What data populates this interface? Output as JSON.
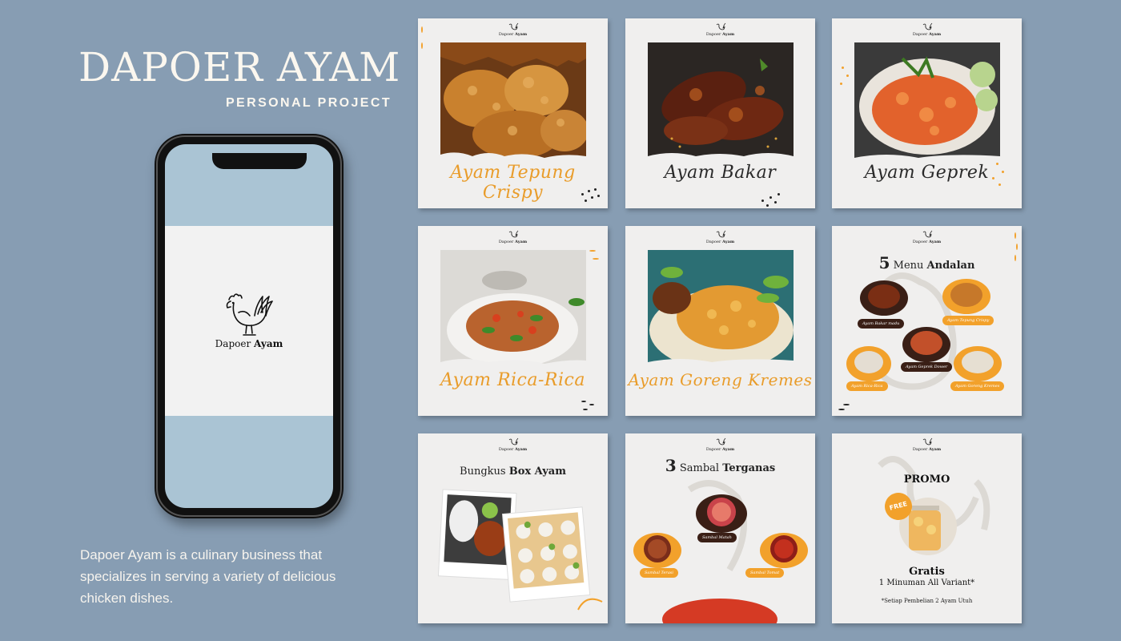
{
  "header": {
    "title": "DAPOER AYAM",
    "subtitle": "PERSONAL PROJECT"
  },
  "phone": {
    "brand_prefix": "Dapoer",
    "brand_bold": "Ayam"
  },
  "description": "Dapoer Ayam is a culinary business that specializes in serving a variety of delicious chicken dishes.",
  "card_brand": {
    "prefix": "Dapoer",
    "bold": "Ayam"
  },
  "cards": [
    {
      "caption": "Ayam Tepung Crispy"
    },
    {
      "caption": "Ayam Bakar"
    },
    {
      "caption": "Ayam Geprek"
    },
    {
      "caption": "Ayam Rica-Rica"
    },
    {
      "caption": "Ayam Goreng Kremes"
    },
    {
      "number": "5",
      "title_plain": "Menu",
      "title_bold": "Andalan",
      "labels": [
        "Ayam Bakar madu",
        "Ayam Tepung Crispy",
        "Ayam Geprek Dower",
        "Ayam Rica-Rica",
        "Ayam Goreng Kremes"
      ]
    },
    {
      "title_plain": "Bungkus",
      "title_bold": "Box Ayam"
    },
    {
      "number": "3",
      "title_plain": "Sambal",
      "title_bold": "Terganas",
      "labels": [
        "Sambal Matah",
        "Sambal Terasi",
        "Sambal Tomat"
      ]
    },
    {
      "title": "PROMO",
      "badge": "FREE",
      "gratis": "Gratis",
      "line": "1 Minuman All Variant*",
      "note": "*Setiap Pembelian 2 Ayam Utuh"
    }
  ],
  "colors": {
    "background": "#879db3",
    "card": "#f0efee",
    "accent": "#f2a12b",
    "dark": "#3a1f16"
  }
}
